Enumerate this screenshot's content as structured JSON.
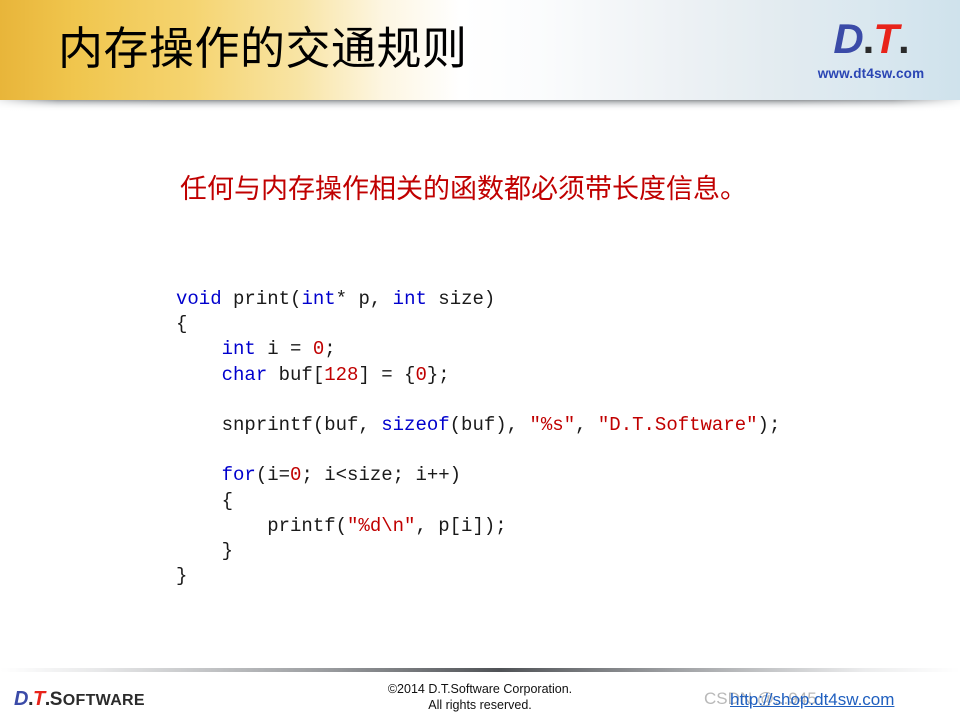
{
  "header": {
    "title": "内存操作的交通规则",
    "logo": {
      "d": "D",
      "dot1": ".",
      "t": "T",
      "dot2": ".",
      "url": "www.dt4sw.com"
    }
  },
  "main": {
    "statement": "任何与内存操作相关的函数都必须带长度信息。",
    "code": {
      "language": "c",
      "lines": [
        [
          {
            "t": "void",
            "c": "kw"
          },
          {
            "t": " print(",
            "c": ""
          },
          {
            "t": "int",
            "c": "kw"
          },
          {
            "t": "* p, ",
            "c": ""
          },
          {
            "t": "int",
            "c": "kw"
          },
          {
            "t": " size)",
            "c": ""
          }
        ],
        [
          {
            "t": "{",
            "c": ""
          }
        ],
        [
          {
            "t": "    ",
            "c": ""
          },
          {
            "t": "int",
            "c": "kw"
          },
          {
            "t": " i = ",
            "c": ""
          },
          {
            "t": "0",
            "c": "num"
          },
          {
            "t": ";",
            "c": ""
          }
        ],
        [
          {
            "t": "    ",
            "c": ""
          },
          {
            "t": "char",
            "c": "kw"
          },
          {
            "t": " buf[",
            "c": ""
          },
          {
            "t": "128",
            "c": "num"
          },
          {
            "t": "] = {",
            "c": ""
          },
          {
            "t": "0",
            "c": "num"
          },
          {
            "t": "};",
            "c": ""
          }
        ],
        [],
        [
          {
            "t": "    snprintf(buf, ",
            "c": ""
          },
          {
            "t": "sizeof",
            "c": "kw"
          },
          {
            "t": "(buf), ",
            "c": ""
          },
          {
            "t": "\"%s\"",
            "c": "str"
          },
          {
            "t": ", ",
            "c": ""
          },
          {
            "t": "\"D.T.Software\"",
            "c": "str"
          },
          {
            "t": ");",
            "c": ""
          }
        ],
        [],
        [
          {
            "t": "    ",
            "c": ""
          },
          {
            "t": "for",
            "c": "kw"
          },
          {
            "t": "(i=",
            "c": ""
          },
          {
            "t": "0",
            "c": "num"
          },
          {
            "t": "; i<size; i++)",
            "c": ""
          }
        ],
        [
          {
            "t": "    {",
            "c": ""
          }
        ],
        [
          {
            "t": "        printf(",
            "c": ""
          },
          {
            "t": "\"%d\\n\"",
            "c": "str"
          },
          {
            "t": ", p[i]);",
            "c": ""
          }
        ],
        [
          {
            "t": "    }",
            "c": ""
          }
        ],
        [
          {
            "t": "}",
            "c": ""
          }
        ]
      ]
    }
  },
  "footer": {
    "logo": {
      "d": "D",
      "dot1": ".",
      "t": "T",
      "dot2": ".",
      "software_cap": "S",
      "software_rest": "OFTWARE"
    },
    "copyright_line1": "©2014 D.T.Software Corporation.",
    "copyright_line2": "All rights reserved.",
    "watermark": "CSDN @...945",
    "shop_link": "http://shop.dt4sw.com"
  },
  "colors": {
    "header_gold": "#e8b53a",
    "header_blue": "#cfe2ec",
    "statement_red": "#c00000",
    "code_keyword_blue": "#0000cd",
    "code_literal_red": "#c00000",
    "logo_d_blue": "#3b4ba8",
    "logo_t_red": "#e8231a",
    "link_blue": "#1f5fbf",
    "watermark_gray": "#b9b9b9",
    "background": "#ffffff"
  }
}
